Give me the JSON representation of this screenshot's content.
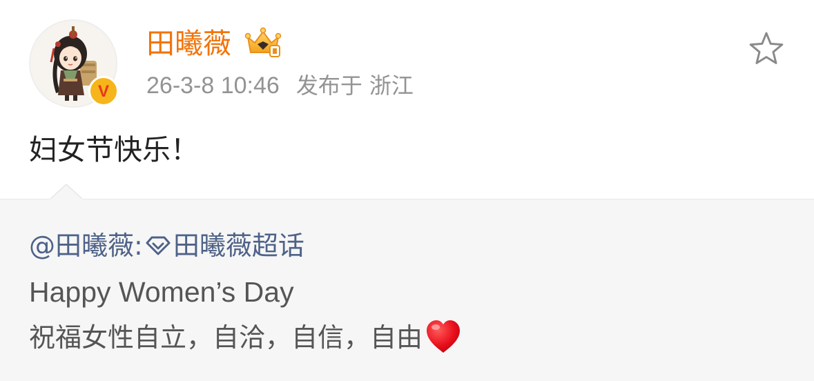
{
  "post": {
    "author": {
      "name": "田曦薇",
      "verified_badge": "V",
      "vip_icon": "crown-icon",
      "colors": {
        "name": "#f2740a",
        "badge": "#f6b51a",
        "badge_text": "#e8361d"
      }
    },
    "meta": {
      "time": "26-3-8 10:46",
      "source_label": "发布于",
      "location": "浙江"
    },
    "text": "妇女节快乐！",
    "actions": {
      "favorite_icon": "star-outline-icon"
    }
  },
  "repost": {
    "mention": "@田曦薇",
    "separator": ":",
    "topic_icon": "diamond-icon",
    "topic": "田曦薇超话",
    "lines": [
      "Happy Women’s Day",
      "祝福女性自立，自洽，自信，自由"
    ],
    "emoji": "heart-icon",
    "colors": {
      "link": "#4e6288",
      "background": "#f6f6f6"
    }
  }
}
